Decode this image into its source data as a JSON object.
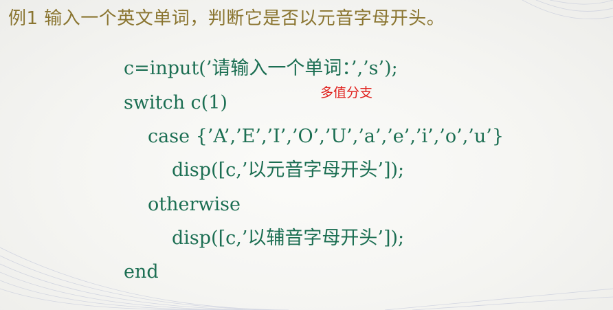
{
  "slide": {
    "title": "例1 输入一个英文单词，判断它是否以元音字母开头。",
    "annotation": "多值分支",
    "code_lines": [
      "c=input(’请输入一个单词：’,’s’);",
      "switch c(1)",
      "case {’A’,’E’,’I’,’O’,’U’,’a’,’e’,’i’,’o’,’u’}",
      "disp([c,’以元音字母开头’]);",
      "otherwise",
      "disp([c,’以辅音字母开头’]);",
      "end"
    ]
  },
  "colors": {
    "title": "#8a7530",
    "code": "#1b6e52",
    "annotation": "#e0201c",
    "background": "#f5f5f2",
    "wave_lines": "#b9bfd6"
  }
}
